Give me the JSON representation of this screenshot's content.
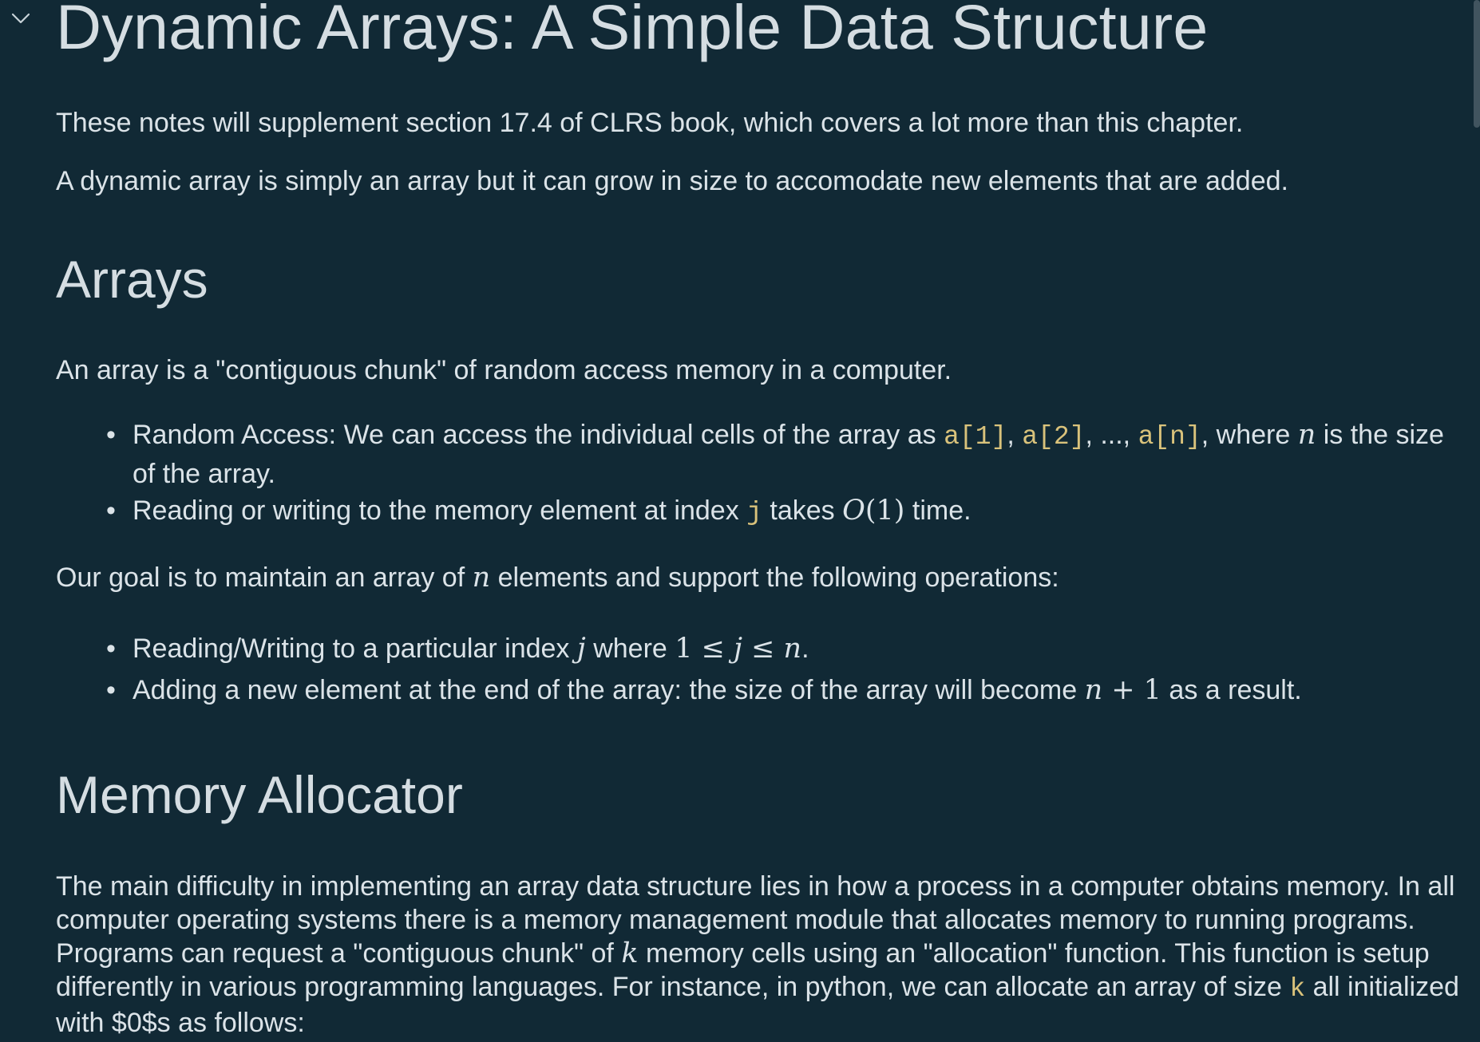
{
  "title": "Dynamic Arrays: A Simple Data Structure",
  "intro": {
    "p1": "These notes will supplement section 17.4 of CLRS book, which covers a lot more than this chapter.",
    "p2": "A dynamic array is simply an array but it can grow in size to accomodate new elements that are added."
  },
  "arrays": {
    "heading": "Arrays",
    "p1": "An array is a \"contiguous chunk\" of random access memory in a computer.",
    "bullet1": {
      "t1": "Random Access: We can access the individual cells of the array as ",
      "c1": "a[1]",
      "s1": ", ",
      "c2": "a[2]",
      "s2": ", ..., ",
      "c3": "a[n]",
      "t2": ", where ",
      "m1": "n",
      "t3": " is the size of the array."
    },
    "bullet2": {
      "t1": "Reading or writing to the memory element at index ",
      "c1": "j",
      "t2": " takes ",
      "m1": "O",
      "m2": "(1)",
      "t3": " time."
    },
    "p2": {
      "t1": "Our goal is to maintain an array of ",
      "m1": "n",
      "t2": " elements and support the following operations:"
    },
    "bullet3": {
      "t1": "Reading/Writing to a particular index ",
      "m1": "j",
      "t2": " where ",
      "m2": "1 ≤ ",
      "m3": "j",
      "m4": " ≤ ",
      "m5": "n",
      "t3": "."
    },
    "bullet4": {
      "t1": "Adding a new element at the end of the array: the size of the array will become ",
      "m1": "n",
      "m2": " + 1",
      "t2": " as a result."
    }
  },
  "memory": {
    "heading": "Memory Allocator",
    "p1": {
      "t1": "The main difficulty in implementing an array data structure lies in how a process in a computer obtains memory. In all computer operating systems there is a memory management module that allocates memory to running programs. Programs can request a \"contiguous chunk\" of ",
      "m1": "k",
      "t2": " memory cells using an \"allocation\" function. This function is setup differently in various programming languages. For instance, in python, we can allocate an array of size ",
      "c1": "k",
      "t3": " all initialized with $0$s as follows:"
    }
  },
  "colors": {
    "background": "#112935",
    "text": "#dbe3e8",
    "code": "#d9c27b"
  },
  "icons": {
    "collapse": "chevron-down-icon"
  }
}
